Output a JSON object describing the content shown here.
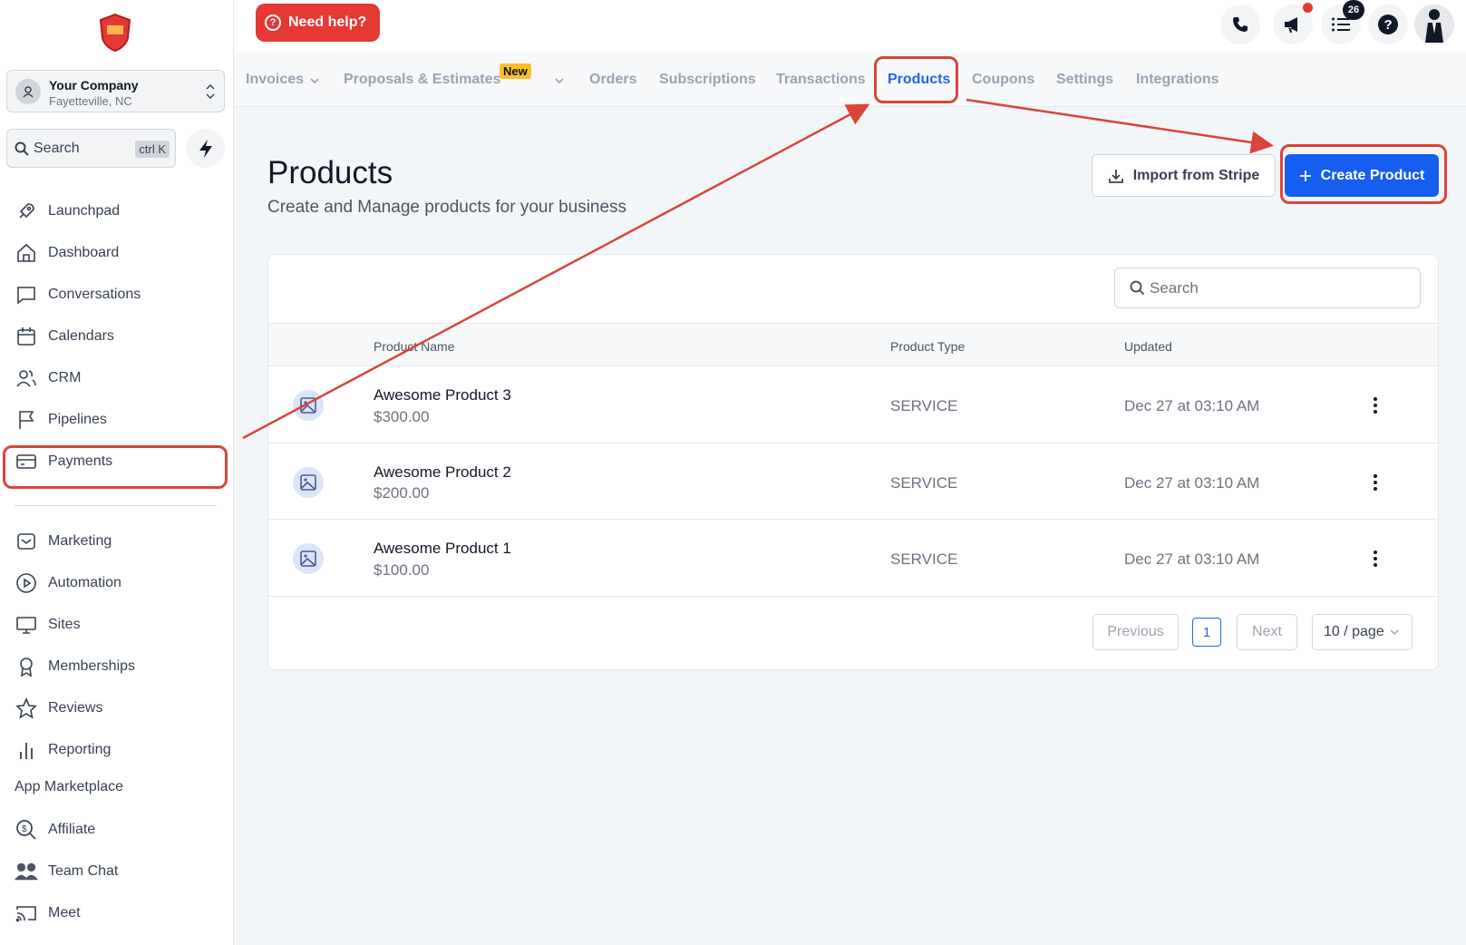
{
  "header": {
    "need_help": "Need help?",
    "list_badge": "26"
  },
  "company": {
    "name": "Your Company",
    "location": "Fayetteville, NC"
  },
  "sidebar_search": {
    "label": "Search",
    "shortcut": "ctrl K"
  },
  "sidebar": {
    "items": [
      {
        "label": "Launchpad",
        "icon": "rocket-icon"
      },
      {
        "label": "Dashboard",
        "icon": "home-icon"
      },
      {
        "label": "Conversations",
        "icon": "chat-icon"
      },
      {
        "label": "Calendars",
        "icon": "calendar-icon"
      },
      {
        "label": "CRM",
        "icon": "users-icon"
      },
      {
        "label": "Pipelines",
        "icon": "flag-icon"
      },
      {
        "label": "Payments",
        "icon": "card-icon"
      },
      {
        "label": "Marketing",
        "icon": "mail-icon"
      },
      {
        "label": "Automation",
        "icon": "play-icon"
      },
      {
        "label": "Sites",
        "icon": "monitor-icon"
      },
      {
        "label": "Memberships",
        "icon": "award-icon"
      },
      {
        "label": "Reviews",
        "icon": "star-icon"
      },
      {
        "label": "Reporting",
        "icon": "bar-chart-icon"
      },
      {
        "label": "App Marketplace",
        "icon": ""
      },
      {
        "label": "Affiliate",
        "icon": "search-dollar-icon"
      },
      {
        "label": "Team Chat",
        "icon": "team-icon"
      },
      {
        "label": "Meet",
        "icon": "cast-icon"
      }
    ]
  },
  "tabs": {
    "invoices": "Invoices",
    "proposals": "Proposals & Estimates",
    "new_badge": "New",
    "orders": "Orders",
    "subscriptions": "Subscriptions",
    "transactions": "Transactions",
    "products": "Products",
    "coupons": "Coupons",
    "settings": "Settings",
    "integrations": "Integrations"
  },
  "page": {
    "title": "Products",
    "subtitle": "Create and Manage products for your business",
    "import_label": "Import from Stripe",
    "create_label": "Create Product"
  },
  "table": {
    "search_placeholder": "Search",
    "columns": [
      "Product Name",
      "Product Type",
      "Updated"
    ],
    "rows": [
      {
        "name": "Awesome Product 3",
        "price": "$300.00",
        "type": "SERVICE",
        "updated": "Dec 27 at 03:10 AM"
      },
      {
        "name": "Awesome Product 2",
        "price": "$200.00",
        "type": "SERVICE",
        "updated": "Dec 27 at 03:10 AM"
      },
      {
        "name": "Awesome Product 1",
        "price": "$100.00",
        "type": "SERVICE",
        "updated": "Dec 27 at 03:10 AM"
      }
    ]
  },
  "pagination": {
    "previous": "Previous",
    "current": "1",
    "next": "Next",
    "page_size": "10 / page"
  },
  "colors": {
    "accent": "#155eef",
    "need_help_bg": "#e53935",
    "annotation": "#d9443b",
    "new_badge": "#fbbf24"
  }
}
